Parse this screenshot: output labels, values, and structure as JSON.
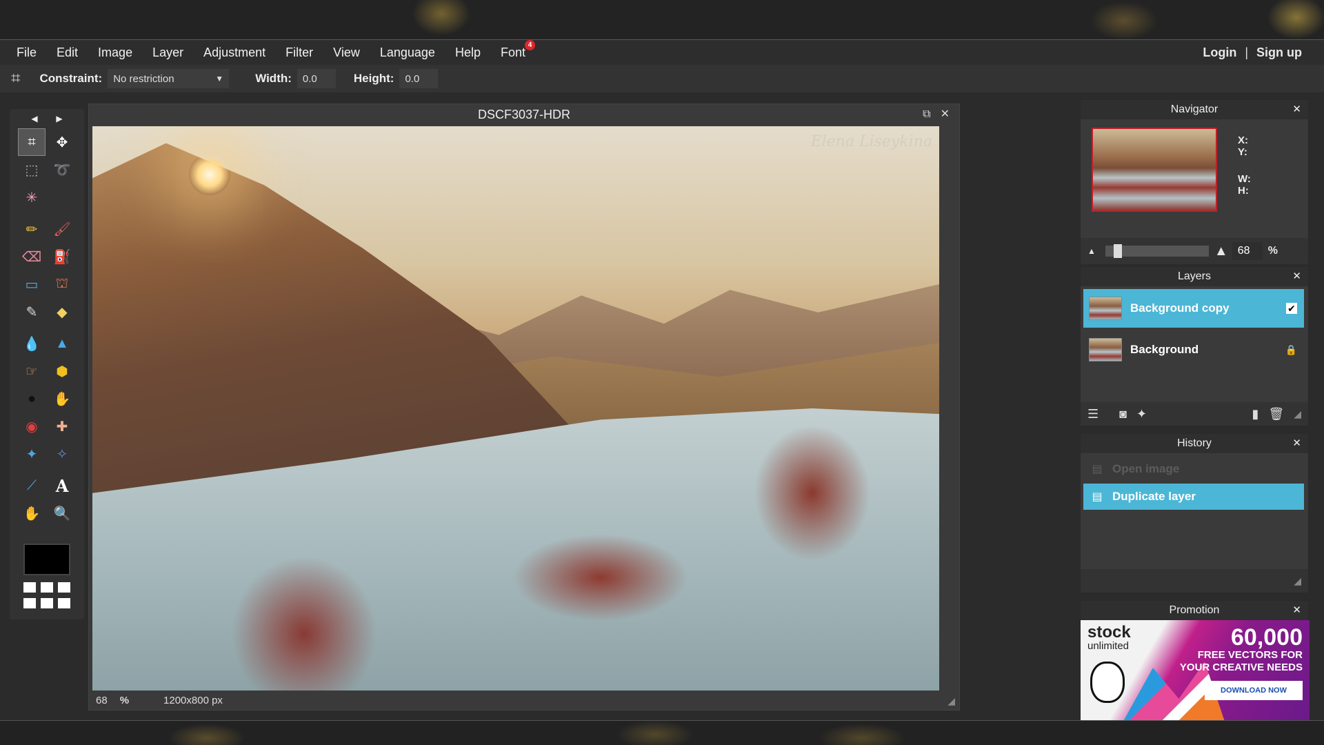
{
  "menu": {
    "items": [
      "File",
      "Edit",
      "Image",
      "Layer",
      "Adjustment",
      "Filter",
      "View",
      "Language",
      "Help",
      "Font"
    ],
    "font_badge": "4",
    "login": "Login",
    "separator": "|",
    "signup": "Sign up"
  },
  "options": {
    "constraint_label": "Constraint:",
    "constraint_value": "No restriction",
    "width_label": "Width:",
    "width_value": "0.0",
    "height_label": "Height:",
    "height_value": "0.0"
  },
  "canvas": {
    "title": "DSCF3037-HDR",
    "watermark": "Elena Liseykina",
    "zoom": "68",
    "zoom_unit": "%",
    "dimensions": "1200x800 px"
  },
  "navigator": {
    "title": "Navigator",
    "x_label": "X:",
    "y_label": "Y:",
    "w_label": "W:",
    "h_label": "H:",
    "zoom_value": "68",
    "zoom_unit": "%"
  },
  "layers": {
    "title": "Layers",
    "items": [
      {
        "name": "Background copy",
        "active": true
      },
      {
        "name": "Background",
        "active": false
      }
    ]
  },
  "history": {
    "title": "History",
    "items": [
      {
        "label": "Open image",
        "active": false
      },
      {
        "label": "Duplicate layer",
        "active": true
      }
    ]
  },
  "promotion": {
    "title": "Promotion",
    "logo": "stock",
    "logo_sub": "unlimited",
    "headline": "60,000",
    "subline1": "FREE VECTORS FOR",
    "subline2": "YOUR CREATIVE NEEDS",
    "button": "DOWNLOAD NOW"
  },
  "colors": {
    "accent": "#4cb6d6",
    "badge": "#e0242b",
    "foreground": "#000000"
  }
}
